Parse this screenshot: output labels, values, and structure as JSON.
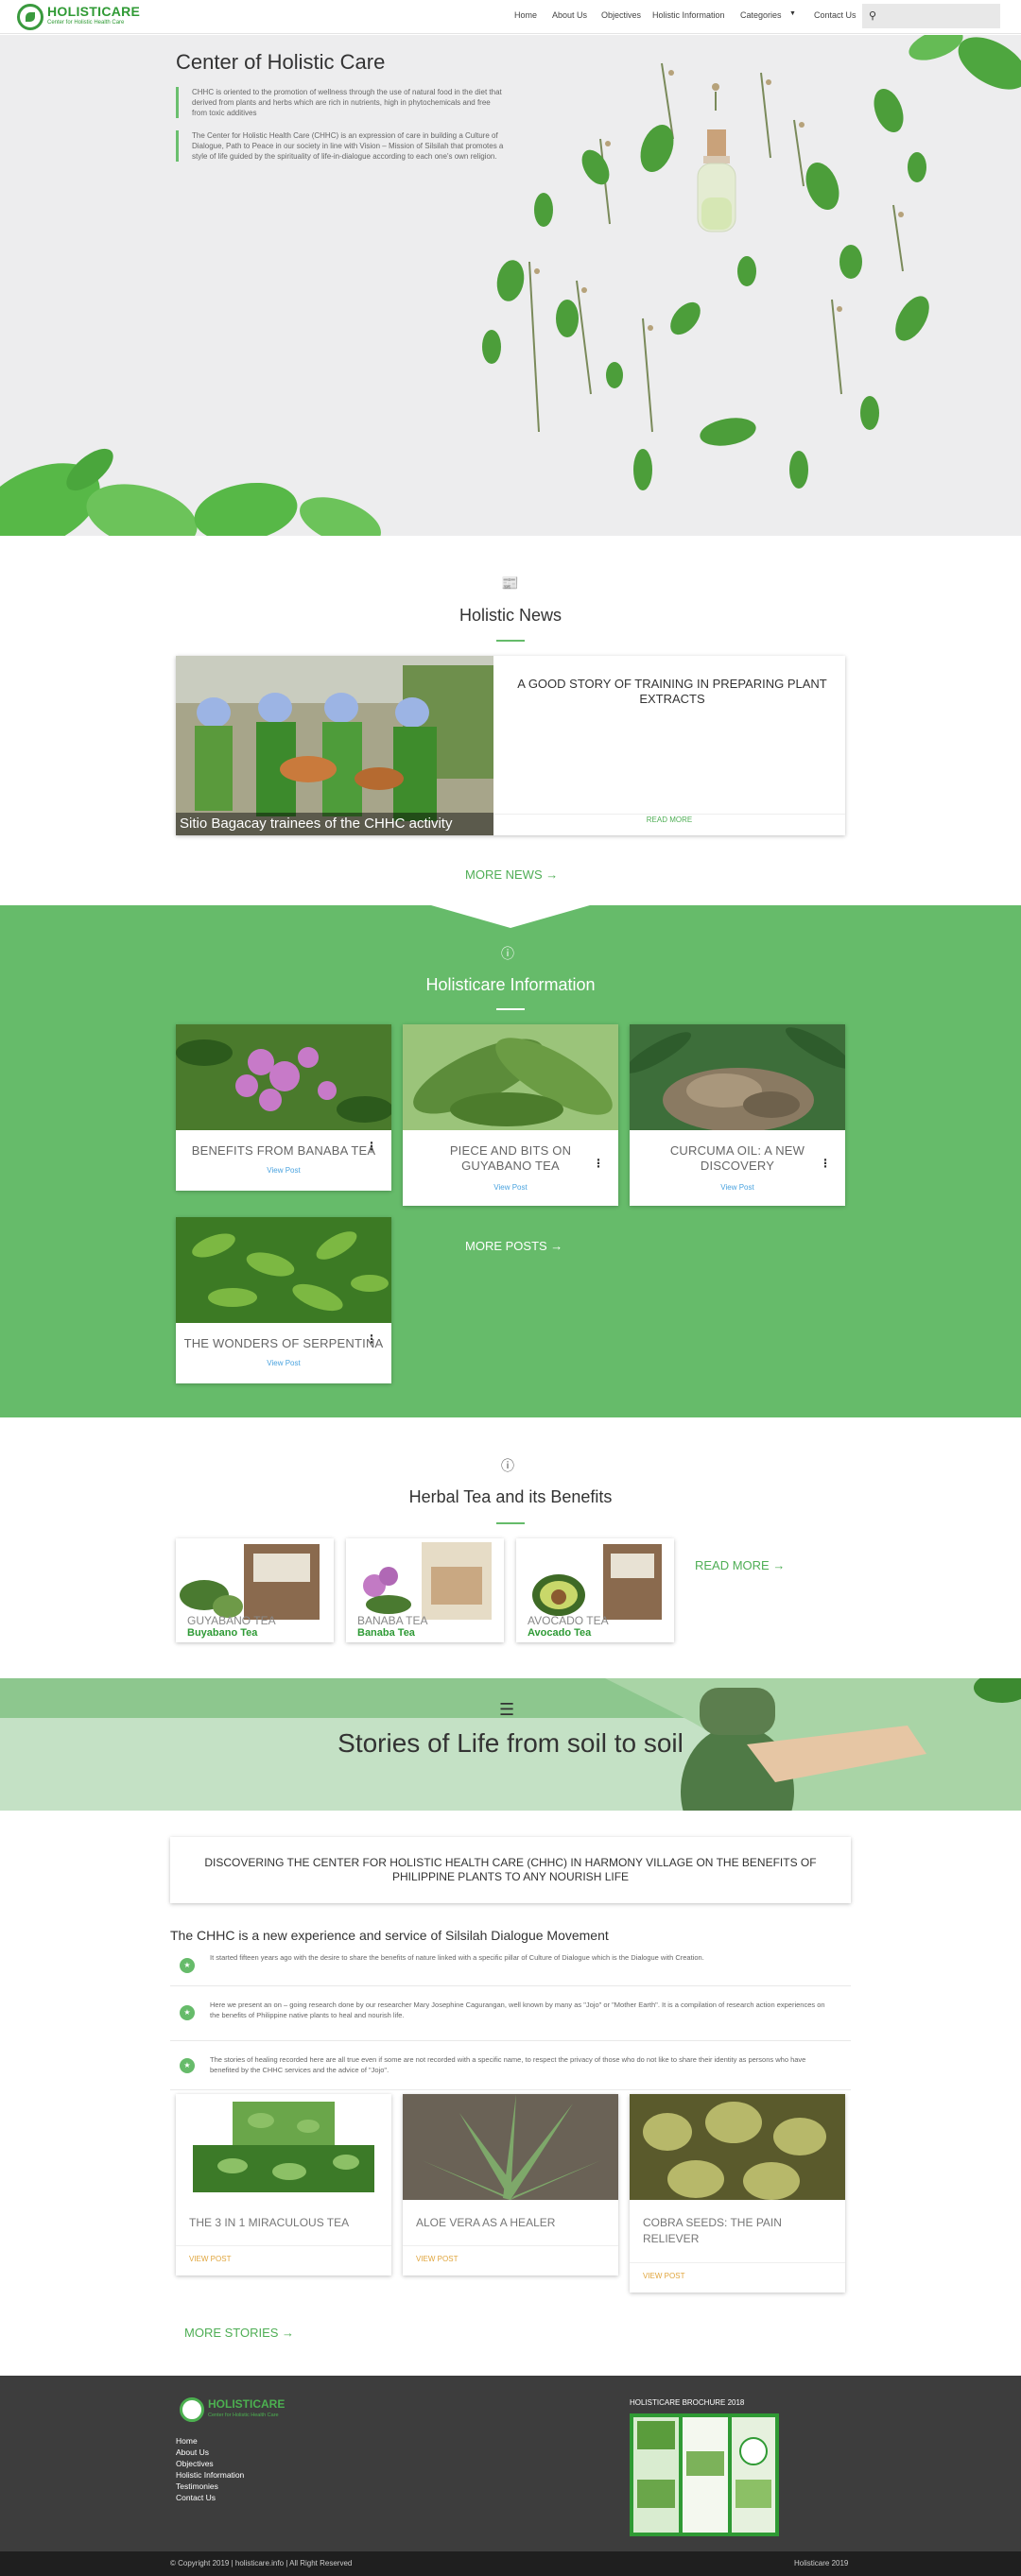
{
  "nav": {
    "brand": "HOLISTICARE",
    "tagline": "Center for Holistic Health Care",
    "links": [
      "Home",
      "About Us",
      "Objectives",
      "Holistic Information",
      "Categories",
      "Contact Us"
    ],
    "search_placeholder": ""
  },
  "hero": {
    "title": "Center of Holistic Care",
    "para1": "CHHC is oriented to the promotion of wellness through the use of natural food in the diet that derived from plants and herbs which are rich in nutrients, high in phytochemicals and free from toxic additives",
    "para2": "The Center for Holistic Health Care (CHHC) is an expression of care in building a Culture of Dialogue, Path to Peace in our society in line with Vision – Mission of Silsilah that promotes a style of life guided by the spirituality of life-in-dialogue according to each one's own religion."
  },
  "news": {
    "title": "Holistic News",
    "caption": "Sitio Bagacay trainees of the CHHC activity",
    "headline": "A GOOD STORY OF TRAINING IN PREPARING PLANT EXTRACTS",
    "read_more": "READ MORE",
    "more": "MORE NEWS →"
  },
  "info": {
    "title": "Holisticare Information",
    "posts": [
      {
        "title": "BENEFITS FROM BANABA TEA",
        "view": "View Post"
      },
      {
        "title": "PIECE AND BITS ON GUYABANO TEA",
        "view": "View Post"
      },
      {
        "title": "CURCUMA OIL: A NEW DISCOVERY",
        "view": "View Post"
      },
      {
        "title": "THE WONDERS OF SERPENTINA",
        "view": "View Post"
      }
    ],
    "more": "MORE POSTS →"
  },
  "tea": {
    "title": "Herbal Tea and its Benefits",
    "items": [
      {
        "label": "GUYABANO TEA",
        "tag": "Buyabano Tea"
      },
      {
        "label": "BANABA TEA",
        "tag": "Banaba Tea"
      },
      {
        "label": "AVOCADO TEA",
        "tag": "Avocado Tea"
      }
    ],
    "more": "READ MORE →"
  },
  "stories": {
    "band_title": "Stories of Life from soil to soil",
    "box_title": "DISCOVERING THE CENTER FOR HOLISTIC HEALTH CARE (CHHC) IN HARMONY VILLAGE ON THE BENEFITS OF PHILIPPINE PLANTS TO ANY NOURISH LIFE",
    "subtitle": "The CHHC is a new experience and service of Silsilah Dialogue Movement",
    "rows": [
      "It started fifteen years ago with the desire to share the benefits of nature linked with a specific pillar of Culture of Dialogue which is the Dialogue with Creation.",
      "Here we present an on – going research done by our researcher Mary Josephine Cagurangan, well known by many as \"Jojo\" or \"Mother Earth\". It is a compilation of research action experiences on the benefits of Philippine native plants to heal and nourish life.",
      "The stories of healing recorded here are all true even if some are not recorded with a specific name, to respect the privacy of those who do not like to share their identity as persons who have benefited by the CHHC services and the advice of \"Jojo\"."
    ],
    "cards": [
      {
        "title": "THE 3 IN 1 MIRACULOUS TEA",
        "view": "VIEW POST"
      },
      {
        "title": "ALOE VERA AS A HEALER",
        "view": "VIEW POST"
      },
      {
        "title": "COBRA SEEDS: THE PAIN RELIEVER",
        "view": "VIEW POST"
      }
    ],
    "more": "MORE STORIES →"
  },
  "footer": {
    "brand": "HOLISTICARE",
    "tagline": "Center for Holistic Health Care",
    "links": [
      "Home",
      "About Us",
      "Objectives",
      "Holistic Information",
      "Testimonies",
      "Contact Us"
    ],
    "brochure_title": "HOLISTICARE BROCHURE 2018",
    "copyright": "© Copyright 2019 | holisticare.info | All Right Reserved",
    "right": "Holisticare 2019"
  }
}
